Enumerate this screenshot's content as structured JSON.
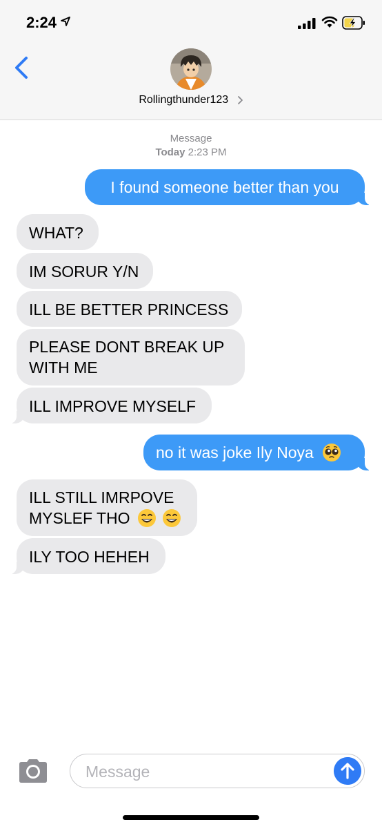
{
  "status_bar": {
    "time": "2:24"
  },
  "header": {
    "contact_name": "Rollingthunder123"
  },
  "timestamp": {
    "service": "Message",
    "day": "Today",
    "time": "2:23 PM"
  },
  "messages": [
    {
      "from": "me",
      "text": "I found someone better than you"
    },
    {
      "from": "them",
      "text": "WHAT?"
    },
    {
      "from": "them",
      "text": "IM SORUR Y/N"
    },
    {
      "from": "them",
      "text": "ILL BE BETTER PRINCESS"
    },
    {
      "from": "them",
      "line1": "PLEASE DONT BREAK UP",
      "line2": "WITH ME"
    },
    {
      "from": "them",
      "text": "ILL IMPROVE MYSELF"
    },
    {
      "from": "me",
      "text": "no it was joke Ily Noya",
      "emoji": "pleading-face-icon"
    },
    {
      "from": "them",
      "line1": "ILL STILL IMRPOVE",
      "line2": "MYSLEF THO",
      "emoji": "grinning-face-icon"
    },
    {
      "from": "them",
      "text": "ILY TOO HEHEH"
    }
  ],
  "composer": {
    "placeholder": "Message"
  },
  "colors": {
    "outgoing": "#3d9af7",
    "incoming": "#e9e9eb",
    "accent": "#2f7bf5"
  }
}
